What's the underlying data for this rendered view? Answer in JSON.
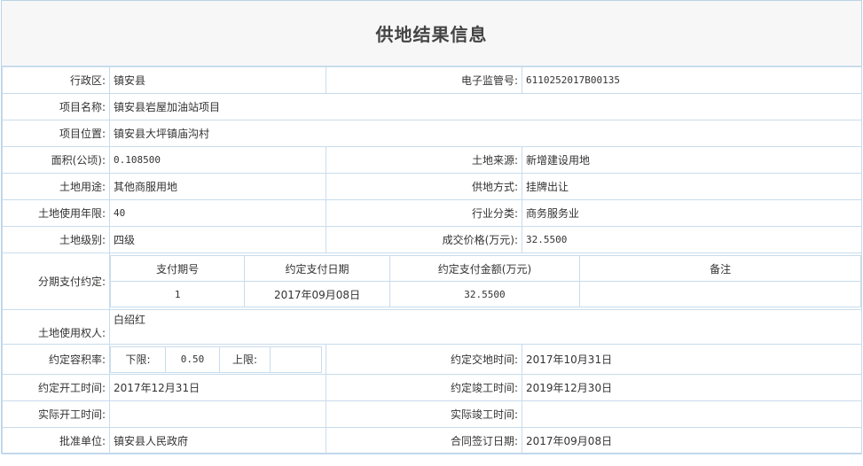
{
  "page": {
    "title": "供地结果信息"
  },
  "rows": {
    "district_label": "行政区:",
    "district_value": "镇安县",
    "supervision_no_label": "电子监管号:",
    "supervision_no_value": "6110252017B00135",
    "project_name_label": "项目名称:",
    "project_name_value": "镇安县岩屋加油站项目",
    "project_location_label": "项目位置:",
    "project_location_value": "镇安县大坪镇庙沟村",
    "area_label": "面积(公顷):",
    "area_value": "0.108500",
    "land_source_label": "土地来源:",
    "land_source_value": "新增建设用地",
    "land_use_label": "土地用途:",
    "land_use_value": "其他商服用地",
    "supply_method_label": "供地方式:",
    "supply_method_value": "挂牌出让",
    "use_years_label": "土地使用年限:",
    "use_years_value": "40",
    "industry_label": "行业分类:",
    "industry_value": "商务服务业",
    "land_level_label": "土地级别:",
    "land_level_value": "四级",
    "price_label": "成交价格(万元):",
    "price_value": "32.5500",
    "installment_label": "分期支付约定:",
    "land_user_label": "土地使用权人:",
    "land_user_value": "白绍红",
    "far_label": "约定容积率:",
    "far_lower_label": "下限:",
    "far_lower_value": "0.50",
    "far_upper_label": "上限:",
    "far_upper_value": "",
    "delivery_time_label": "约定交地时间:",
    "delivery_time_value": "2017年10月31日",
    "start_time_label": "约定开工时间:",
    "start_time_value": "2017年12月31日",
    "complete_time_label": "约定竣工时间:",
    "complete_time_value": "2019年12月30日",
    "actual_start_label": "实际开工时间:",
    "actual_start_value": "",
    "actual_complete_label": "实际竣工时间:",
    "actual_complete_value": "",
    "approver_label": "批准单位:",
    "approver_value": "镇安县人民政府",
    "contract_date_label": "合同签订日期:",
    "contract_date_value": "2017年09月08日"
  },
  "installments": {
    "headers": [
      "支付期号",
      "约定支付日期",
      "约定支付金额(万元)",
      "备注"
    ],
    "rows": [
      [
        "1",
        "2017年09月08日",
        "32.5500",
        ""
      ]
    ]
  }
}
